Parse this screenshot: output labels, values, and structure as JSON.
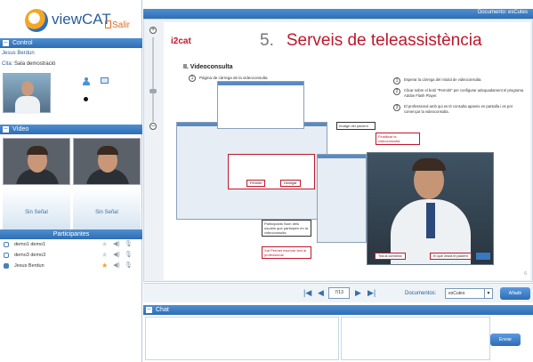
{
  "app": {
    "name": "viewCAT",
    "exit_label": "Salir"
  },
  "control": {
    "title": "Control",
    "user_name": "Jesus Berdun",
    "site_label": "Cita:",
    "site_value": "Sala demostració"
  },
  "video": {
    "title": "Vídeo",
    "no_signal_1": "Sin Señal",
    "no_signal_2": "Sin Señal"
  },
  "participants": {
    "title": "Participantes",
    "rows": [
      {
        "name": "demo1 demo1",
        "starred": false,
        "active": false
      },
      {
        "name": "demo3 demo3",
        "starred": false,
        "active": false
      },
      {
        "name": "Jesus Berdun",
        "starred": true,
        "active": true
      }
    ]
  },
  "document": {
    "header": "Documento: esCutes",
    "slide_logo": "i2cat",
    "slide_number": "5.",
    "slide_title": "Serveis de teleassistència",
    "section": "II.   Videoconsulta",
    "step1": "Pàgina de càrrega de la videoconsulta",
    "steps": [
      {
        "n": "1",
        "text": "Esperar la càrrega del mòdul de videoconsulta."
      },
      {
        "n": "2",
        "text": "Clicar sobre el botó \"Permitir\" per configurar adequadament el programa Adobe Flash Player."
      },
      {
        "n": "3",
        "text": "El professional amb qui es té consulta apareix en pantalla i es pot començar la videoconsulta."
      }
    ],
    "callout_image": "Imatge del pacient",
    "callout_finish": "Finalitzar la videoconsulta",
    "callout_participants": "Participants Nom dels usuaris que participen en la videoconsulta",
    "callout_you": "Xat Permet escriure text al professional",
    "dv_btn_close": "Tria la connexió",
    "dv_btn_patient": "El que veurà el pacient",
    "dialog_permit": "Permitir",
    "dialog_deny": "Denegar"
  },
  "pagination": {
    "page": "7/13",
    "documents_label": "Documentos:",
    "documents_value": "esCutes",
    "add_label": "Añadir"
  },
  "chat": {
    "title": "Chat",
    "send_label": "Enviar"
  }
}
